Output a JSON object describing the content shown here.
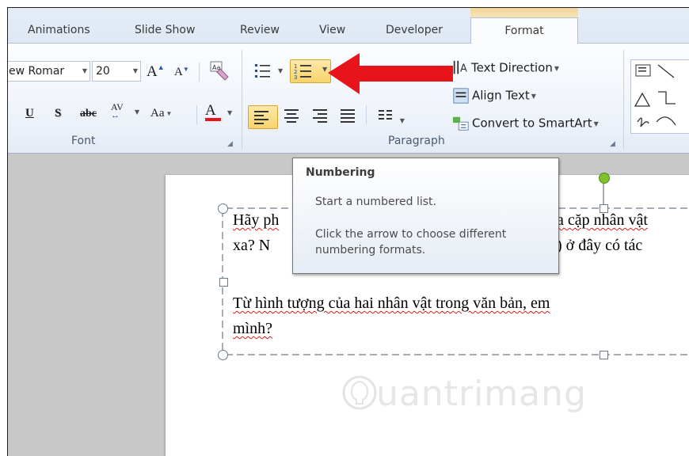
{
  "tabs": [
    {
      "label": "Animations",
      "active": false
    },
    {
      "label": "Slide Show",
      "active": false
    },
    {
      "label": "Review",
      "active": false
    },
    {
      "label": "View",
      "active": false
    },
    {
      "label": "Developer",
      "active": false
    },
    {
      "label": "Format",
      "active": true
    }
  ],
  "font_group": {
    "label": "Font",
    "font_name": "ew Romar",
    "font_size": "20",
    "grow_font": "A",
    "shrink_font": "A",
    "underline": "U",
    "shadow": "S",
    "strikethrough": "abc",
    "char_spacing": "AV",
    "change_case": "Aa",
    "font_color": "A",
    "font_color_hex": "#e8141b"
  },
  "paragraph_group": {
    "label": "Paragraph",
    "text_direction": "Text Direction",
    "align_text": "Align Text",
    "convert_smartart": "Convert to SmartArt"
  },
  "tooltip": {
    "title": "Numbering",
    "line1": "Start a numbered list.",
    "line2": "Click the arrow to choose different",
    "line3": "numbering formats."
  },
  "slide": {
    "line1a": "Hãy ph",
    "line1b": "ủa cặp nhân vật",
    "line2a": "xa?  N",
    "line2b": "n) ở đây có tác",
    "line3": "Từ hình tượng của hai nhân vật trong văn bản, em",
    "line4": "mình?"
  },
  "watermark": "uantrimang",
  "colors": {
    "arrow": "#e8141b",
    "highlight": "#f7d36a",
    "handle_green": "#7dc22d"
  }
}
